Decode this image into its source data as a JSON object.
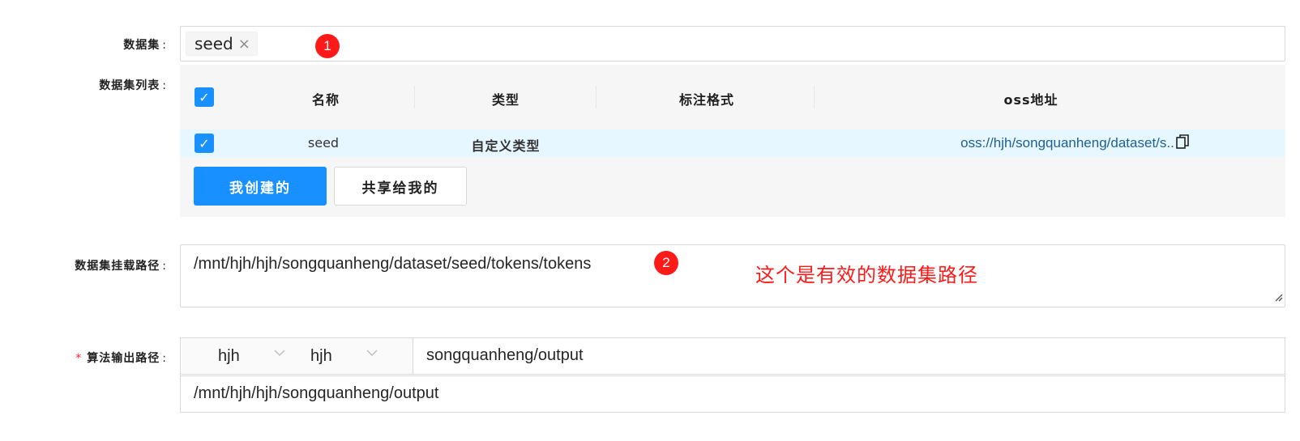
{
  "form": {
    "dataset_label": "数据集",
    "dataset_list_label": "数据集列表",
    "mount_path_label": "数据集挂载路径",
    "output_path_label": "算法输出路径",
    "colon": ":",
    "required_mark": "*"
  },
  "dataset_select": {
    "tags": [
      "seed"
    ],
    "tag_close": "×"
  },
  "badges": {
    "one": "1",
    "two": "2"
  },
  "table": {
    "columns": [
      "名称",
      "类型",
      "标注格式",
      "oss地址"
    ],
    "rows": [
      {
        "name": "seed",
        "type": "自定义类型",
        "annotation_format": "",
        "oss": "oss://hjh/songquanheng/dataset/s.."
      }
    ]
  },
  "buttons": {
    "mine": "我创建的",
    "shared": "共享给我的"
  },
  "mount_path": {
    "value": "/mnt/hjh/hjh/songquanheng/dataset/seed/tokens/tokens",
    "annotation": "这个是有效的数据集路径"
  },
  "output": {
    "select1": "hjh",
    "select2": "hjh",
    "input": "songquanheng/output",
    "full_path": "/mnt/hjh/hjh/songquanheng/output"
  },
  "colors": {
    "primary": "#1890ff",
    "annotation_red": "#ff1a1a",
    "row_highlight": "#e6f7ff"
  }
}
